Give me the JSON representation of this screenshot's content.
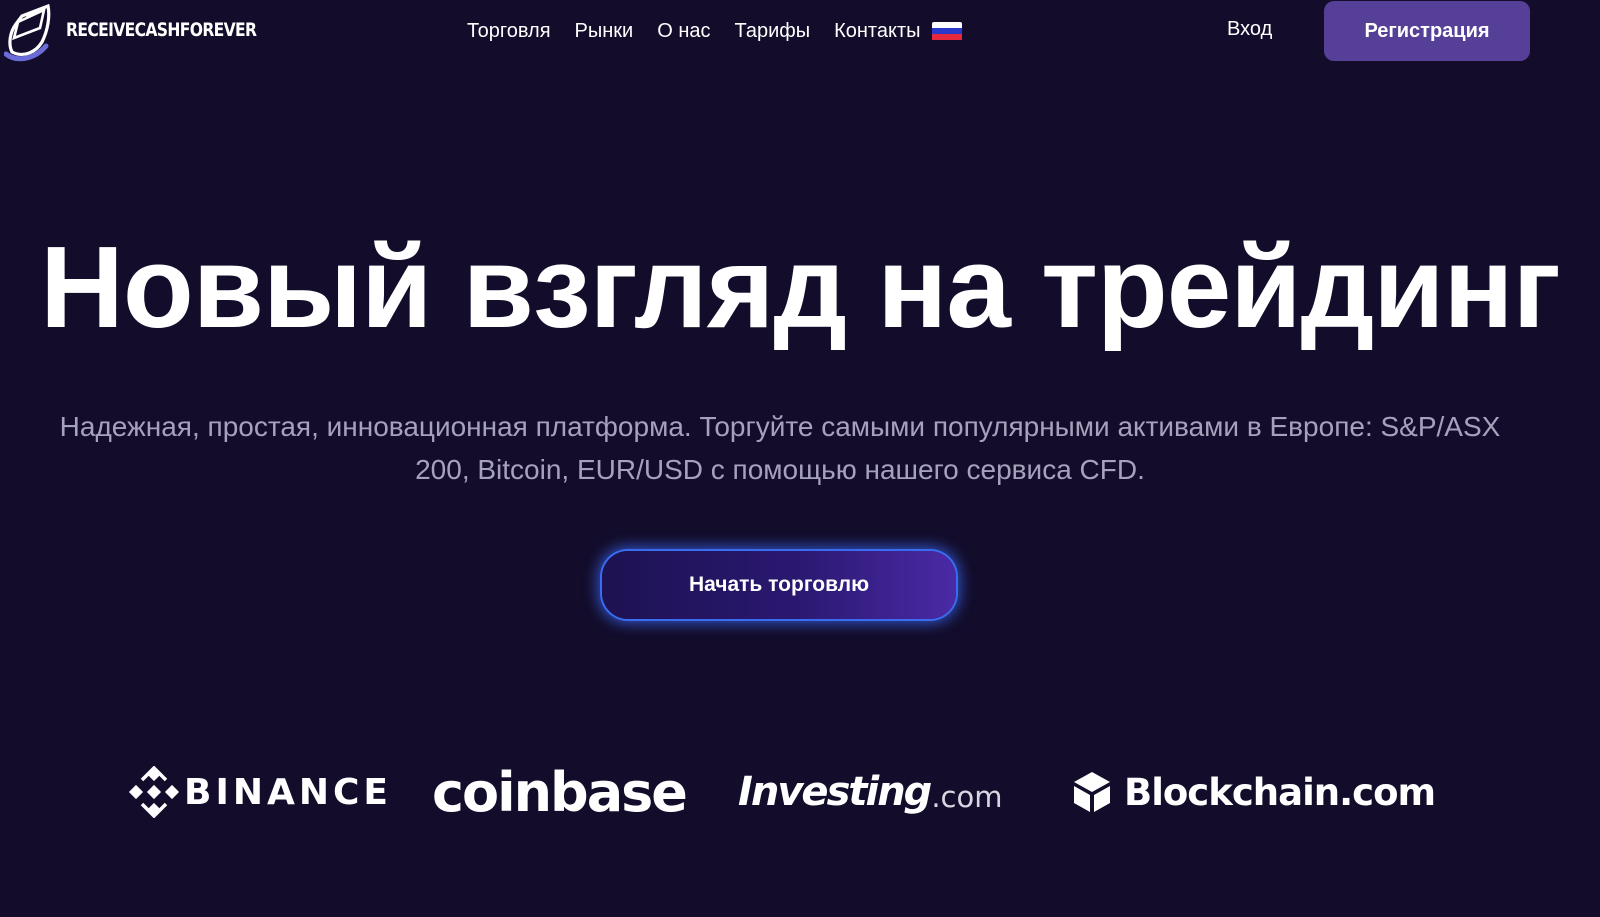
{
  "brand": {
    "name": "RECEIVECASHFOREVER",
    "logo_icon": "shield-card-icon"
  },
  "nav": {
    "items": [
      {
        "label": "Торговля"
      },
      {
        "label": "Рынки"
      },
      {
        "label": "О нас"
      },
      {
        "label": "Тарифы"
      },
      {
        "label": "Контакты"
      }
    ],
    "language_icon": "flag-ru-icon"
  },
  "auth": {
    "login_label": "Вход",
    "register_label": "Регистрация"
  },
  "hero": {
    "title": "Новый взгляд на трейдинг",
    "subtitle": "Надежная, простая, инновационная платформа. Торгуйте самыми популярными активами в Европе: S&P/ASX 200, Bitcoin, EUR/USD с помощью нашего сервиса CFD.",
    "cta_label": "Начать торговлю"
  },
  "partners": {
    "binance": "BINANCE",
    "coinbase": "coinbase",
    "investing": "Investing",
    "investing_suffix": ".com",
    "blockchain": "Blockchain.com"
  },
  "colors": {
    "background": "#130d2b",
    "register_button": "#553f97",
    "cta_glow": "#3a6cf0",
    "subtitle_text": "#a7a2bb"
  }
}
